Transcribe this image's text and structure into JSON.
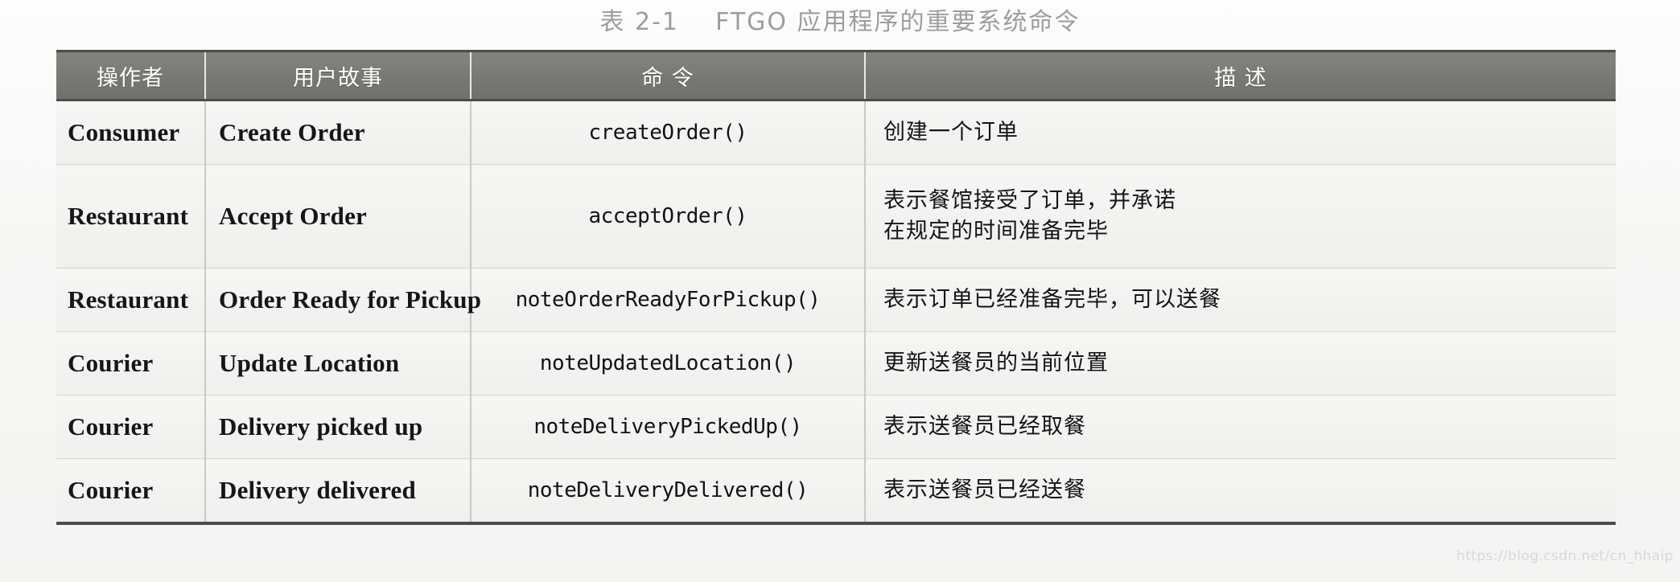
{
  "caption": {
    "label": "表 2-1",
    "title": "FTGO 应用程序的重要系统命令"
  },
  "table": {
    "headers": [
      {
        "id": "actor",
        "label": "操作者"
      },
      {
        "id": "story",
        "label": "用户故事"
      },
      {
        "id": "command",
        "label": "命 令"
      },
      {
        "id": "desc",
        "label": "描 述"
      }
    ],
    "rows": [
      {
        "actor": "Consumer",
        "story": "Create Order",
        "command": "createOrder()",
        "desc": "创建一个订单"
      },
      {
        "actor": "Restaurant",
        "story": "Accept Order",
        "command": "acceptOrder()",
        "desc_line1": "表示餐馆接受了订单，并承诺",
        "desc_line2": "在规定的时间准备完毕"
      },
      {
        "actor": "Restaurant",
        "story": "Order Ready for Pickup",
        "command": "noteOrderReadyForPickup()",
        "desc": "表示订单已经准备完毕，可以送餐"
      },
      {
        "actor": "Courier",
        "story": "Update Location",
        "command": "noteUpdatedLocation()",
        "desc": "更新送餐员的当前位置"
      },
      {
        "actor": "Courier",
        "story": "Delivery picked up",
        "command": "noteDeliveryPickedUp()",
        "desc": "表示送餐员已经取餐"
      },
      {
        "actor": "Courier",
        "story": "Delivery delivered",
        "command": "noteDeliveryDelivered()",
        "desc": "表示送餐员已经送餐"
      }
    ]
  },
  "watermark": {
    "text": "https://blog.csdn.net/cn_hhaip"
  },
  "colors": {
    "header_bg": "#777773",
    "header_text": "#ffffff",
    "body_bg": "#f2f2f0",
    "rule": "#4c4c4a",
    "caption_text": "#9d9d9d",
    "watermark_text": "#d8d8d8"
  }
}
